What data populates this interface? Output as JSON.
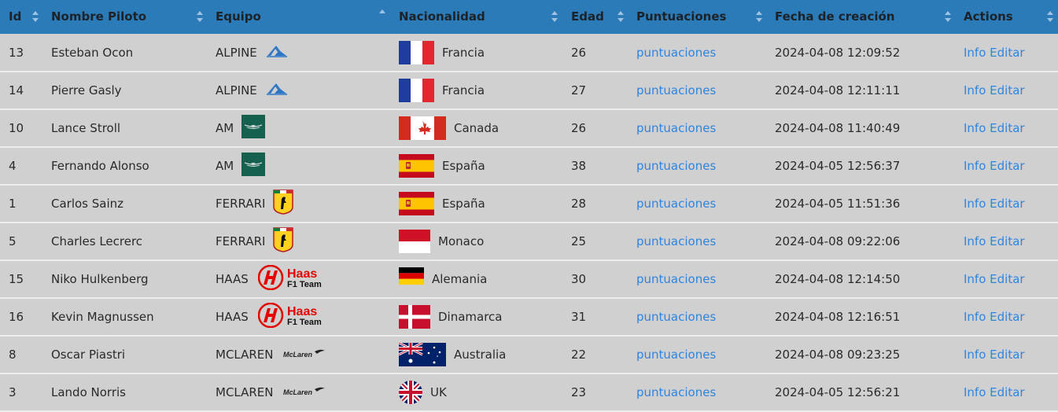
{
  "headers": {
    "id": "Id",
    "piloto": "Nombre Piloto",
    "equipo": "Equipo",
    "nacionalidad": "Nacionalidad",
    "edad": "Edad",
    "puntuaciones": "Puntuaciones",
    "fecha": "Fecha de creación",
    "actions": "Actions"
  },
  "rows": [
    {
      "id": "13",
      "nombre": "Esteban Ocon",
      "equipo": "ALPINE",
      "team_logo": "alpine-logo",
      "nac": "Francia",
      "flag": "france-flag",
      "edad": "26",
      "punt": "puntuaciones",
      "fecha": "2024-04-08 12:09:52",
      "info": "Info",
      "editar": "Editar"
    },
    {
      "id": "14",
      "nombre": "Pierre Gasly",
      "equipo": "ALPINE",
      "team_logo": "alpine-logo",
      "nac": "Francia",
      "flag": "france-flag",
      "edad": "27",
      "punt": "puntuaciones",
      "fecha": "2024-04-08 12:11:11",
      "info": "Info",
      "editar": "Editar"
    },
    {
      "id": "10",
      "nombre": "Lance Stroll",
      "equipo": "AM",
      "team_logo": "aston-martin-logo",
      "nac": "Canada",
      "flag": "canada-flag",
      "edad": "26",
      "punt": "puntuaciones",
      "fecha": "2024-04-08 11:40:49",
      "info": "Info",
      "editar": "Editar"
    },
    {
      "id": "4",
      "nombre": "Fernando Alonso",
      "equipo": "AM",
      "team_logo": "aston-martin-logo",
      "nac": "España",
      "flag": "spain-flag",
      "edad": "38",
      "punt": "puntuaciones",
      "fecha": "2024-04-05 12:56:37",
      "info": "Info",
      "editar": "Editar"
    },
    {
      "id": "1",
      "nombre": "Carlos Sainz",
      "equipo": "FERRARI",
      "team_logo": "ferrari-logo",
      "nac": "España",
      "flag": "spain-flag",
      "edad": "28",
      "punt": "puntuaciones",
      "fecha": "2024-04-05 11:51:36",
      "info": "Info",
      "editar": "Editar"
    },
    {
      "id": "5",
      "nombre": "Charles Lecrerc",
      "equipo": "FERRARI",
      "team_logo": "ferrari-logo",
      "nac": "Monaco",
      "flag": "monaco-flag",
      "edad": "25",
      "punt": "puntuaciones",
      "fecha": "2024-04-08 09:22:06",
      "info": "Info",
      "editar": "Editar"
    },
    {
      "id": "15",
      "nombre": "Niko Hulkenberg",
      "equipo": "HAAS",
      "team_logo": "haas-logo",
      "nac": "Alemania",
      "flag": "germany-flag",
      "edad": "30",
      "punt": "puntuaciones",
      "fecha": "2024-04-08 12:14:50",
      "info": "Info",
      "editar": "Editar"
    },
    {
      "id": "16",
      "nombre": "Kevin Magnussen",
      "equipo": "HAAS",
      "team_logo": "haas-logo",
      "nac": "Dinamarca",
      "flag": "denmark-flag",
      "edad": "31",
      "punt": "puntuaciones",
      "fecha": "2024-04-08 12:16:51",
      "info": "Info",
      "editar": "Editar"
    },
    {
      "id": "8",
      "nombre": "Oscar Piastri",
      "equipo": "MCLAREN",
      "team_logo": "mclaren-logo",
      "nac": "Australia",
      "flag": "australia-flag",
      "edad": "22",
      "punt": "puntuaciones",
      "fecha": "2024-04-08 09:23:25",
      "info": "Info",
      "editar": "Editar"
    },
    {
      "id": "3",
      "nombre": "Lando Norris",
      "equipo": "MCLAREN",
      "team_logo": "mclaren-logo",
      "nac": "UK",
      "flag": "uk-flag",
      "edad": "23",
      "punt": "puntuaciones",
      "fecha": "2024-04-05 12:56:21",
      "info": "Info",
      "editar": "Editar"
    }
  ],
  "logo_text": {
    "haas_1": "Haas",
    "haas_2": "F1 Team",
    "mclaren": "McLaren"
  },
  "colors": {
    "header_bg": "#2b7bb8",
    "row_bg": "#d0d0d0",
    "link": "#2f84e0",
    "separator": "#ececec"
  }
}
